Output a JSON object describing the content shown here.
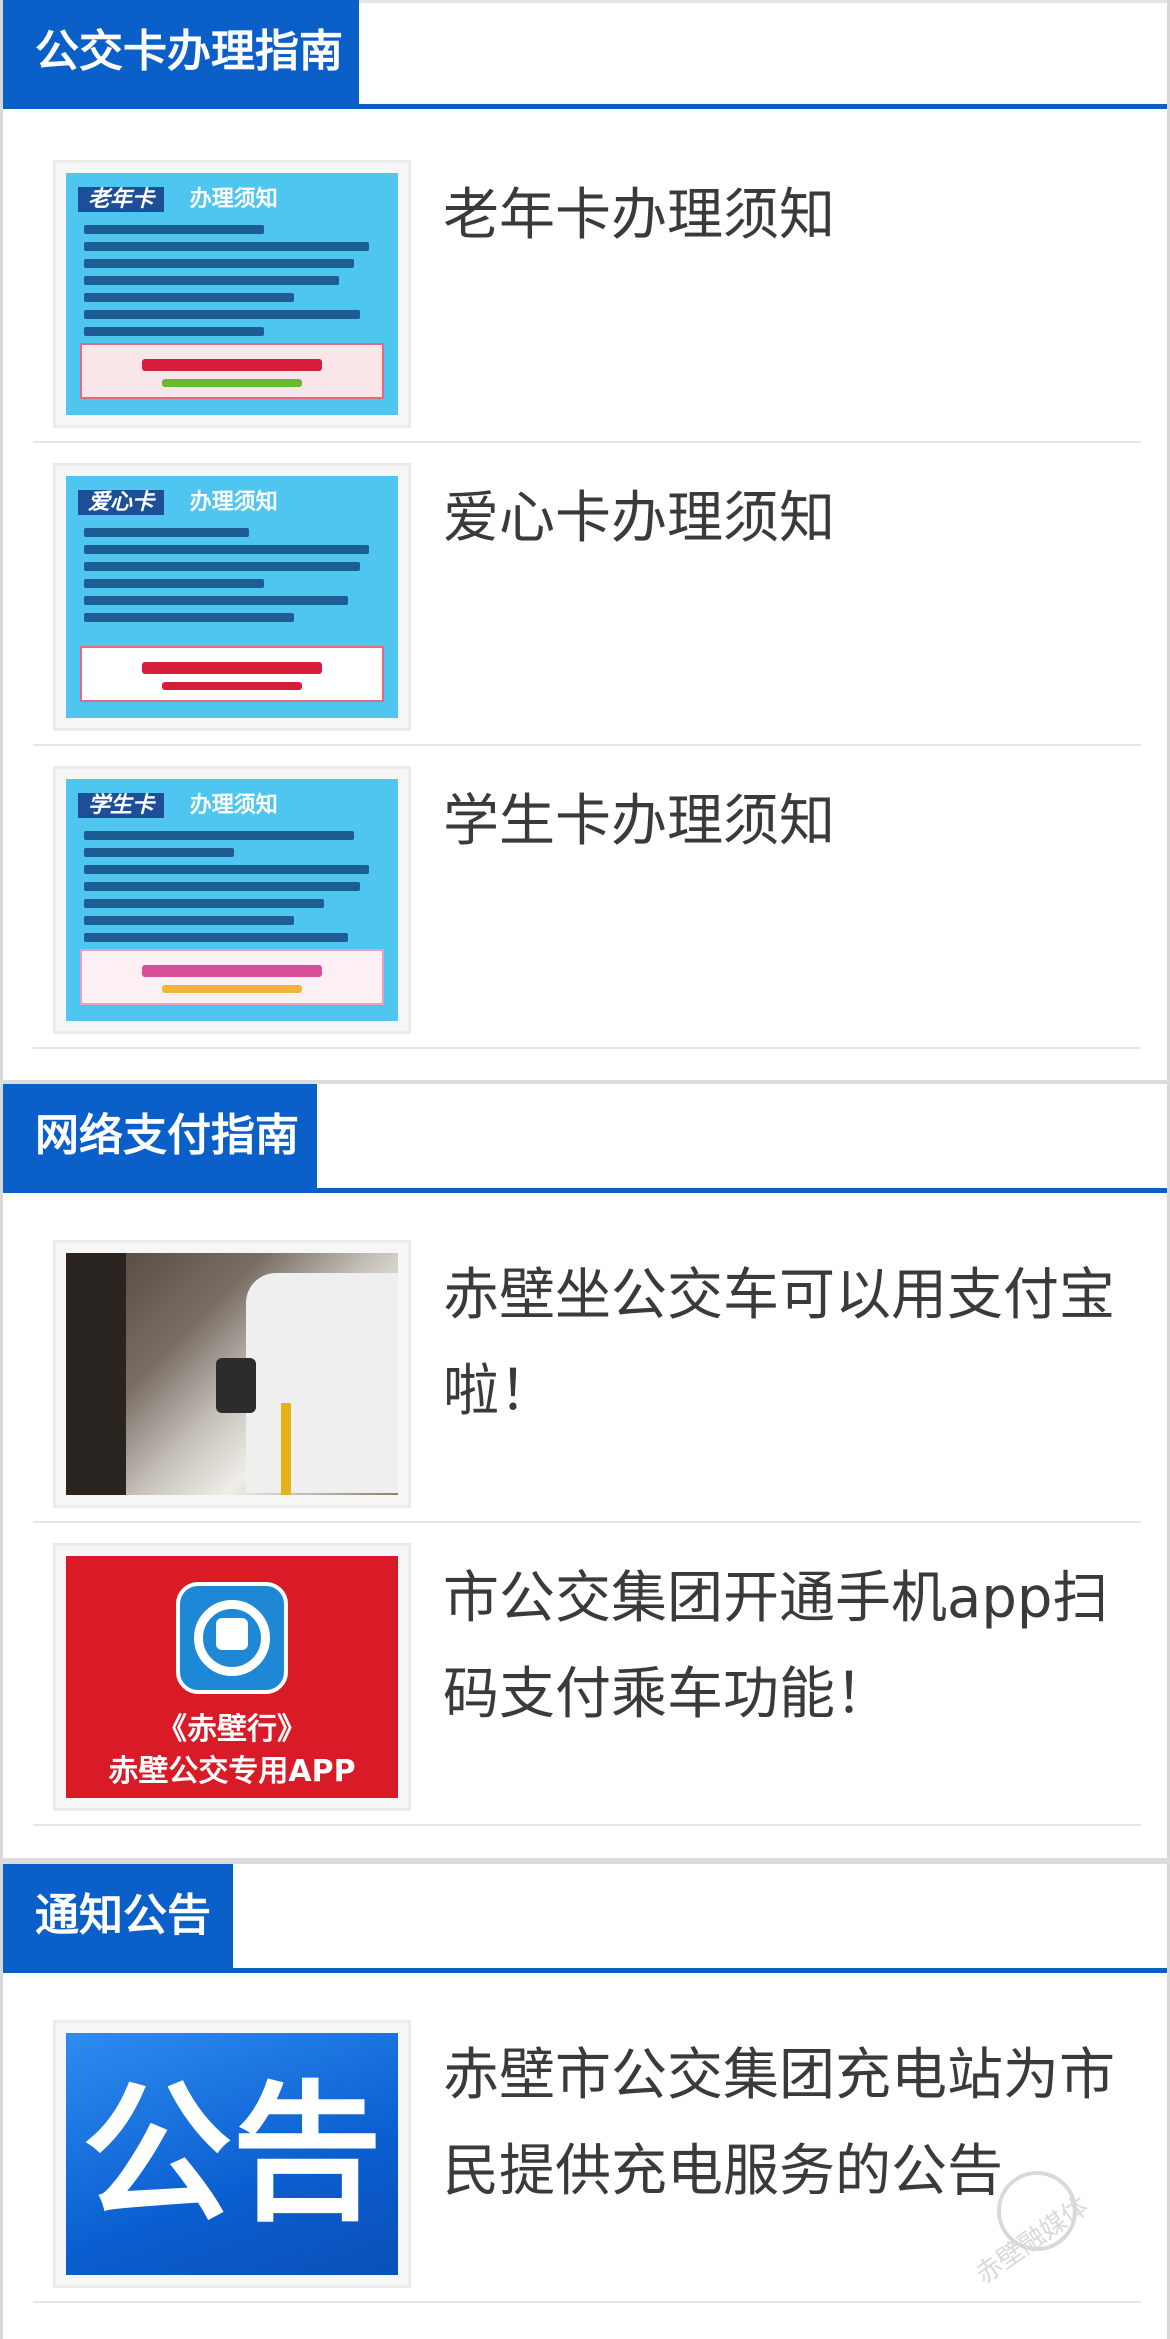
{
  "sections": [
    {
      "title": "公交卡办理指南",
      "items": [
        {
          "title": "老年卡办理须知",
          "thumb": {
            "heading": "老年卡",
            "subheading": "办理须知"
          }
        },
        {
          "title": "爱心卡办理须知",
          "thumb": {
            "heading": "爱心卡",
            "subheading": "办理须知"
          }
        },
        {
          "title": "学生卡办理须知",
          "thumb": {
            "heading": "学生卡",
            "subheading": "办理须知"
          }
        }
      ]
    },
    {
      "title": "网络支付指南",
      "items": [
        {
          "title": "赤壁坐公交车可以用支付宝啦！"
        },
        {
          "title": "市公交集团开通手机app扫码支付乘车功能！",
          "thumb": {
            "line1": "《赤壁行》",
            "line2": "赤壁公交专用APP"
          }
        }
      ]
    },
    {
      "title": "通知公告",
      "items": [
        {
          "title": "赤壁市公交集团充电站为市民提供充电服务的公告",
          "thumb": {
            "text": "公告"
          }
        }
      ]
    }
  ],
  "watermark": {
    "text": "赤壁融媒体"
  },
  "colors": {
    "accent": "#0b5fc8",
    "divider": "#e6e6e6"
  }
}
